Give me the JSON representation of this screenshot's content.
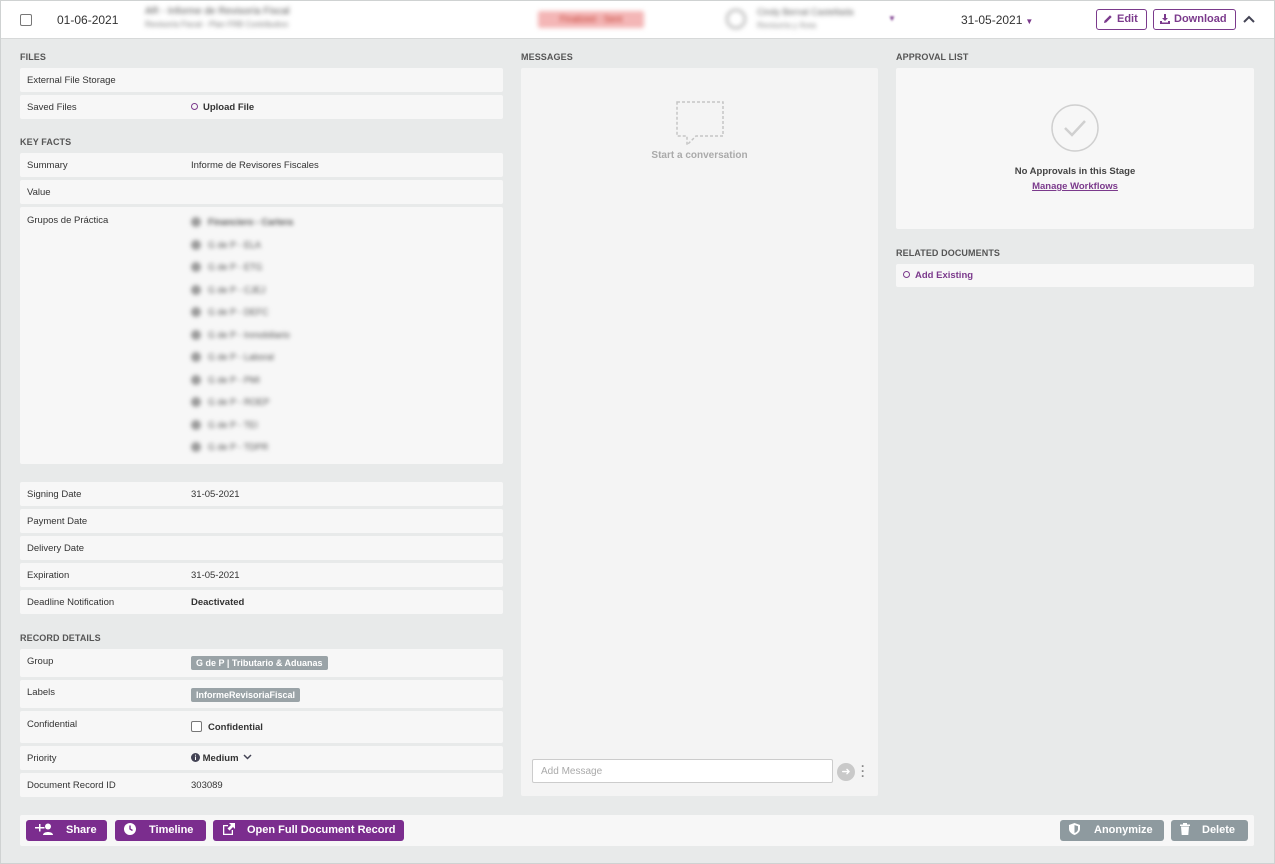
{
  "header_row": {
    "date": "01-06-2021",
    "title_line1": "AR - Informe de Revisoría Fiscal",
    "title_line2": "Revisoría Fiscal - Plan FRB Contributivo",
    "status": "Finalized - Sent",
    "assignee_line1": "Cindy Bernal Castellada",
    "assignee_line2": "Revisoría y Área",
    "due_date": "31-05-2021",
    "edit_label": "Edit",
    "download_label": "Download"
  },
  "files": {
    "section_title": "FILES",
    "external_storage_label": "External File Storage",
    "saved_files_label": "Saved Files",
    "upload_label": "Upload File"
  },
  "key_facts": {
    "section_title": "KEY FACTS",
    "summary_label": "Summary",
    "summary_value": "Informe de Revisores Fiscales",
    "value_label": "Value",
    "grupos_label": "Grupos de Práctica",
    "grupos": [
      "Financiero - Cartera",
      "G de P - ELA",
      "G de P - ETG",
      "G de P - CJEJ",
      "G de P - DEFC",
      "G de P - Inmobiliario",
      "G de P - Laboral",
      "G de P - PMI",
      "G de P - ROEP",
      "G de P - TEI",
      "G de P - TDPR"
    ],
    "signing_label": "Signing Date",
    "signing_value": "31-05-2021",
    "payment_label": "Payment Date",
    "delivery_label": "Delivery Date",
    "expiration_label": "Expiration",
    "expiration_value": "31-05-2021",
    "deadline_label": "Deadline Notification",
    "deadline_value": "Deactivated"
  },
  "record_details": {
    "section_title": "RECORD DETAILS",
    "group_label": "Group",
    "group_value": "G de P | Tributario & Aduanas",
    "labels_label": "Labels",
    "labels_value": "InformeRevisoriaFiscal",
    "confidential_label": "Confidential",
    "confidential_checkbox_label": "Confidential",
    "priority_label": "Priority",
    "priority_value": "Medium",
    "record_id_label": "Document Record ID",
    "record_id_value": "303089"
  },
  "messages": {
    "section_title": "MESSAGES",
    "empty_text": "Start a conversation",
    "input_placeholder": "Add Message"
  },
  "approval": {
    "section_title": "APPROVAL LIST",
    "empty_text": "No Approvals in this Stage",
    "manage_link": "Manage Workflows"
  },
  "related": {
    "section_title": "RELATED DOCUMENTS",
    "add_label": "Add Existing"
  },
  "footer": {
    "share_label": "Share",
    "timeline_label": "Timeline",
    "open_full_label": "Open Full Document Record",
    "anonymize_label": "Anonymize",
    "delete_label": "Delete"
  },
  "colors": {
    "accent": "#7b2d8e",
    "secondary_button": "#8e9a9f",
    "panel": "#f7f7f7",
    "background": "#e8eaea"
  }
}
